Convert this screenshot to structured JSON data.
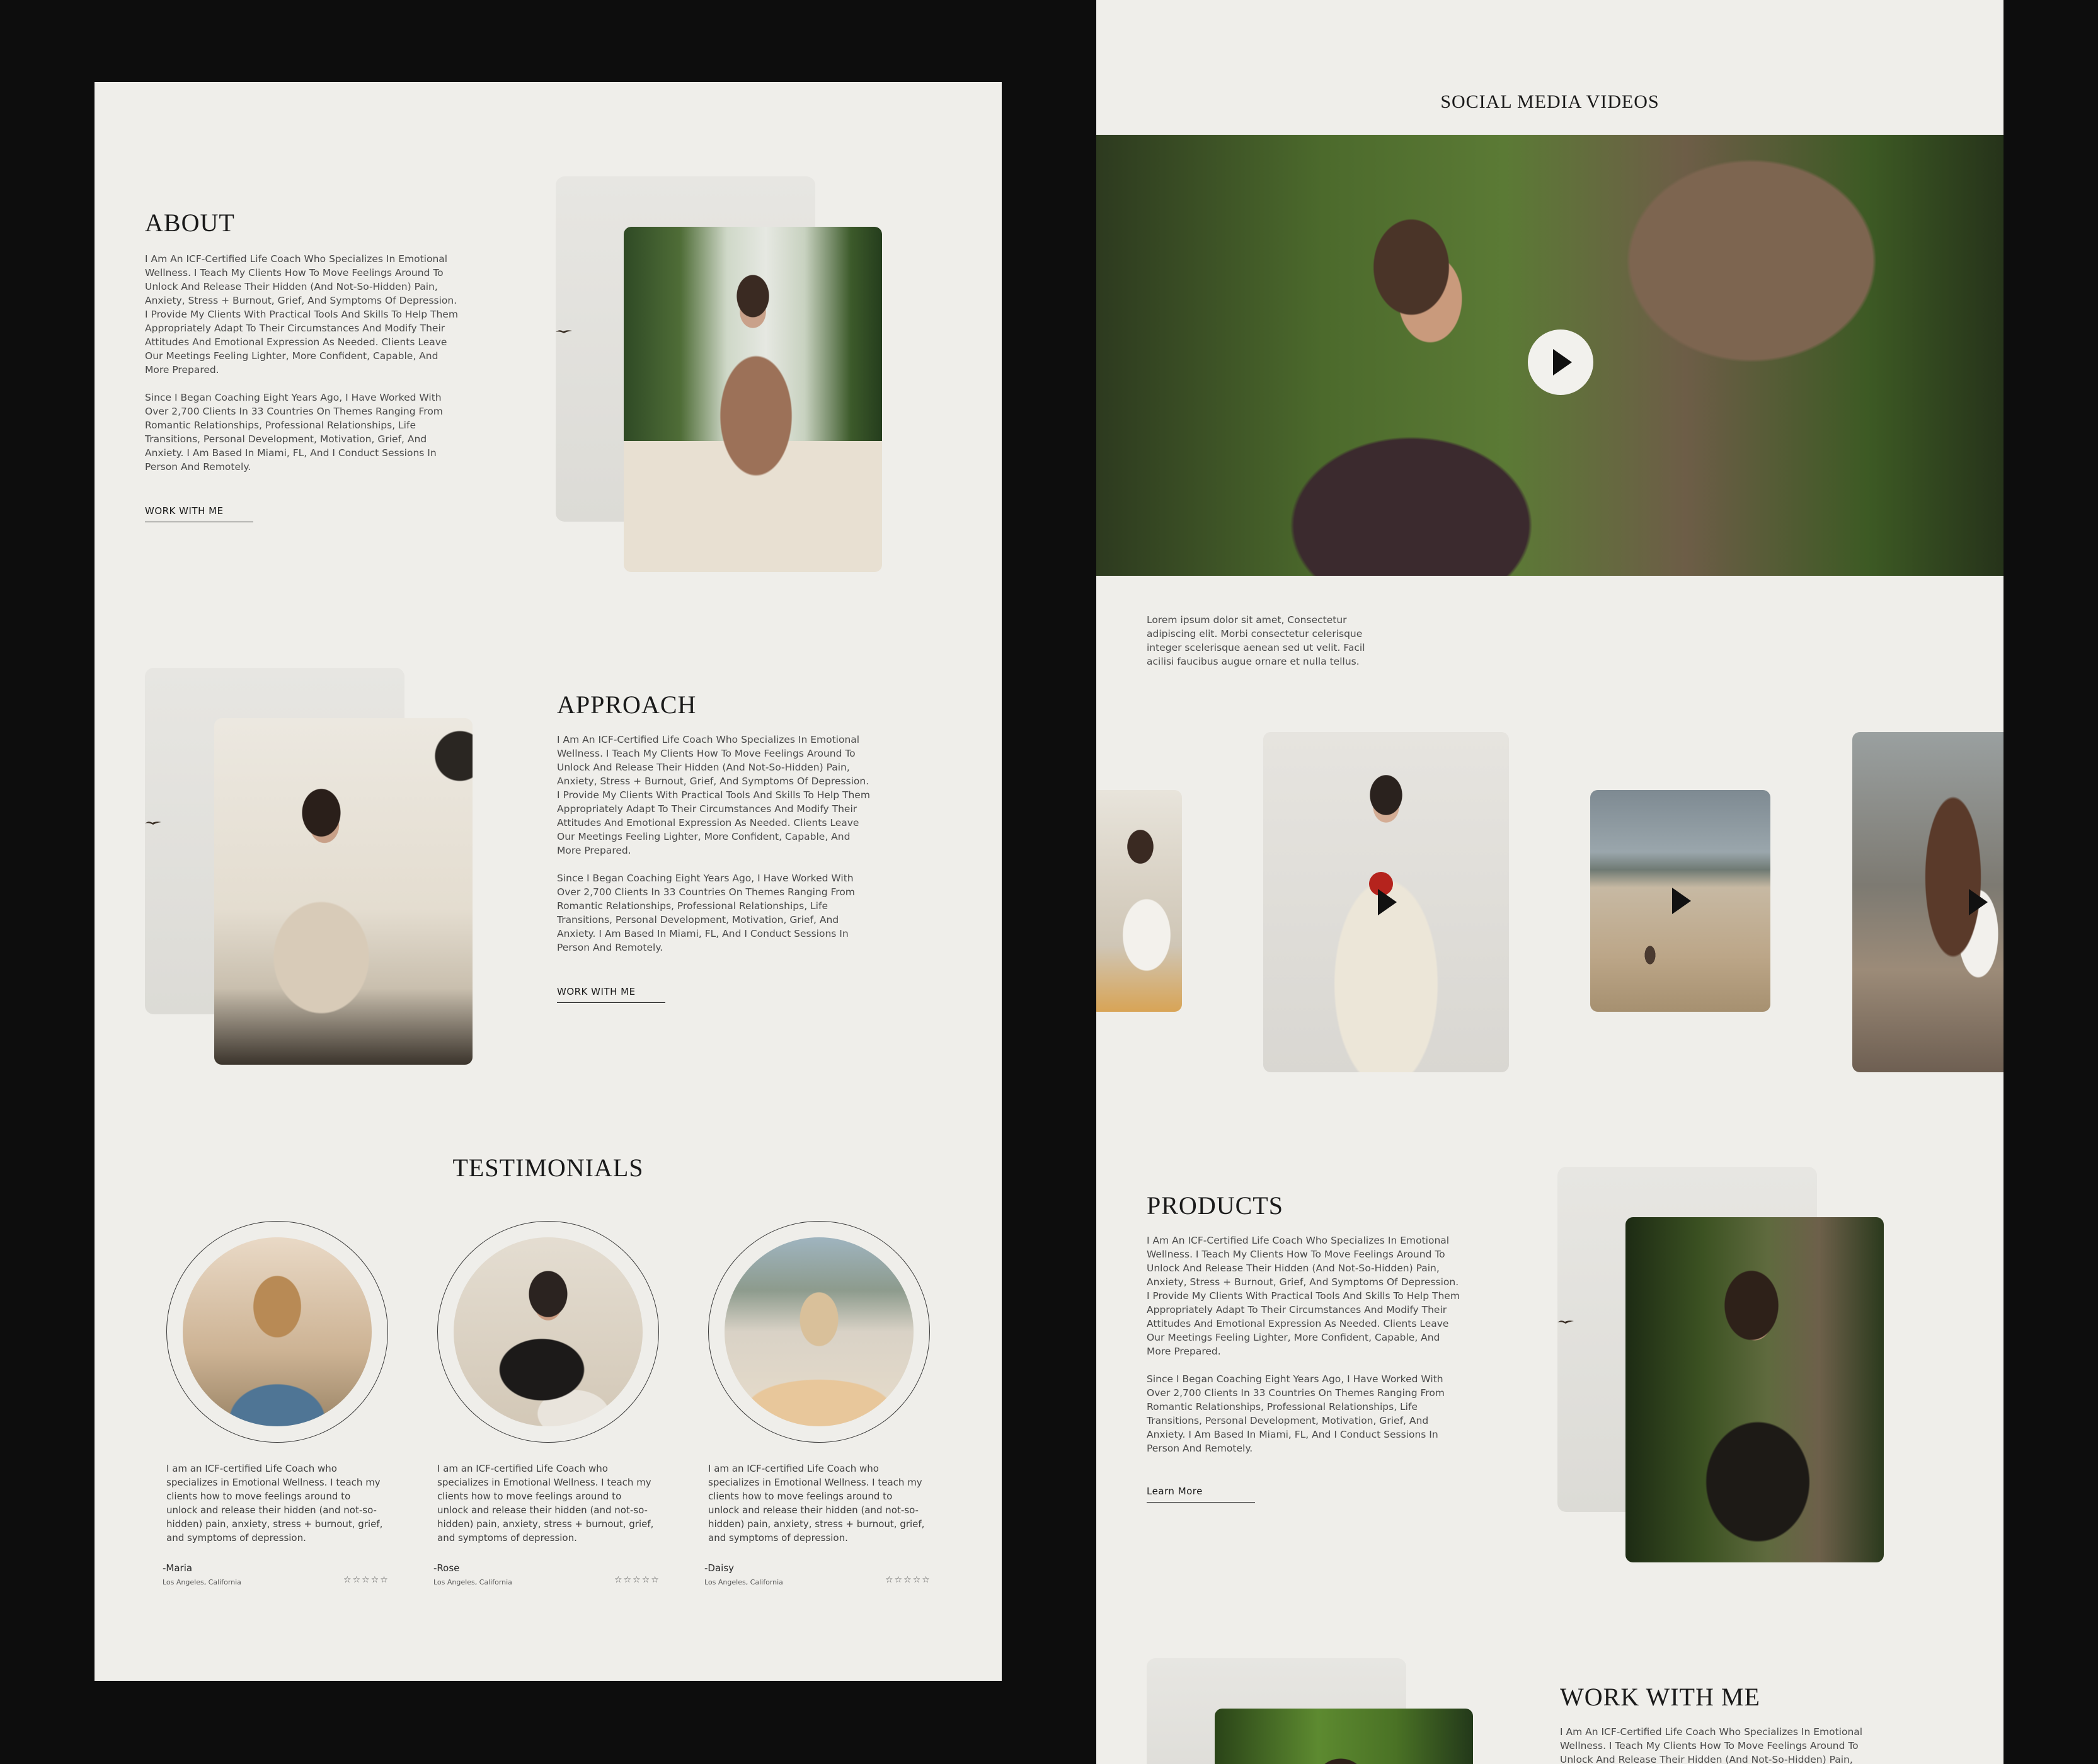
{
  "left_page": {
    "about": {
      "title": "ABOUT",
      "paragraph_1": "I Am An ICF-Certified Life Coach Who Specializes In Emotional Wellness. I Teach My Clients How To Move Feelings Around To Unlock And Release Their Hidden (And Not-So-Hidden) Pain, Anxiety, Stress + Burnout, Grief, And Symptoms Of Depression. I Provide My Clients With Practical Tools And Skills To Help Them Appropriately Adapt To Their Circumstances And Modify Their Attitudes And Emotional Expression As Needed. Clients Leave Our Meetings Feeling Lighter, More Confident, Capable, And More Prepared.",
      "paragraph_2": "Since I Began Coaching Eight Years Ago, I Have Worked With Over 2,700 Clients In 33 Countries On Themes Ranging From Romantic Relationships, Professional Relationships, Life Transitions, Personal Development, Motivation, Grief, And Anxiety. I Am Based In Miami, FL, And I Conduct Sessions In Person And Remotely.",
      "cta": "WORK WITH ME"
    },
    "approach": {
      "title": "APPROACH",
      "paragraph_1": "I Am An ICF-Certified Life Coach Who Specializes In Emotional Wellness. I Teach My Clients How To Move Feelings Around To Unlock And Release Their Hidden (And Not-So-Hidden) Pain, Anxiety, Stress + Burnout, Grief, And Symptoms Of Depression. I Provide My Clients With Practical Tools And Skills To Help Them Appropriately Adapt To Their Circumstances And Modify Their Attitudes And Emotional Expression As Needed. Clients Leave Our Meetings Feeling Lighter, More Confident, Capable, And More Prepared.",
      "paragraph_2": "Since I Began Coaching Eight Years Ago, I Have Worked With Over 2,700 Clients In 33 Countries On Themes Ranging From Romantic Relationships, Professional Relationships, Life Transitions, Personal Development, Motivation, Grief, And Anxiety. I Am Based In Miami, FL, And I Conduct Sessions In Person And Remotely.",
      "cta": "WORK WITH ME"
    },
    "testimonials": {
      "title": "TESTIMONIALS",
      "items": [
        {
          "text": "I am an ICF-certified Life Coach who specializes in Emotional Wellness. I teach my clients how to move feelings around to unlock and release their hidden (and not-so-hidden) pain, anxiety, stress + burnout, grief,  and symptoms of depression.",
          "name": "-Maria",
          "location": "Los Angeles, California",
          "stars": "☆☆☆☆☆"
        },
        {
          "text": "I am an ICF-certified Life Coach who specializes in Emotional Wellness. I teach my clients how to move feelings around to unlock and release their hidden (and not-so-hidden) pain, anxiety, stress + burnout, grief,  and symptoms of depression.",
          "name": "-Rose",
          "location": "Los Angeles, California",
          "stars": "☆☆☆☆☆"
        },
        {
          "text": "I am an ICF-certified Life Coach who specializes in Emotional Wellness. I teach my clients how to move feelings around to unlock and release their hidden (and not-so-hidden) pain, anxiety, stress + burnout, grief,  and symptoms of depression.",
          "name": "-Daisy",
          "location": "Los Angeles, California",
          "stars": "☆☆☆☆☆"
        }
      ]
    }
  },
  "right_page": {
    "social": {
      "title": "SOCIAL MEDIA VIDEOS",
      "description": "Lorem ipsum dolor sit amet, Consectetur  adipiscing elit. Morbi consectetur celerisque integer scelerisque aenean sed ut velit. Facil acilisi faucibus augue ornare et nulla tellus."
    },
    "products": {
      "title": "PRODUCTS",
      "paragraph_1": "I Am An ICF-Certified Life Coach Who Specializes In Emotional Wellness. I Teach My Clients How To Move Feelings Around To Unlock And Release Their Hidden (And Not-So-Hidden) Pain, Anxiety, Stress + Burnout, Grief, And Symptoms Of Depression. I Provide My Clients With Practical Tools And Skills To Help Them Appropriately Adapt To Their Circumstances And Modify Their Attitudes And Emotional Expression As Needed. Clients Leave Our Meetings Feeling Lighter, More Confident, Capable, And More Prepared.",
      "paragraph_2": "Since I Began Coaching Eight Years Ago, I Have Worked With Over 2,700 Clients In 33 Countries On Themes Ranging From Romantic Relationships, Professional Relationships, Life Transitions, Personal Development, Motivation, Grief, And Anxiety. I Am Based In Miami, FL, And I Conduct Sessions In Person And Remotely.",
      "cta": "Learn More"
    },
    "work_with_me": {
      "title": "WORK WITH ME",
      "paragraph_1": "I Am An ICF-Certified Life Coach Who Specializes In Emotional Wellness. I Teach My Clients How To Move Feelings Around To Unlock And Release Their Hidden (And Not-So-Hidden) Pain,"
    }
  },
  "colors": {
    "page_background": "#0d0d0d",
    "card_background": "#efeeea",
    "text": "#1a1a1a"
  },
  "icons": [
    "bird-icon",
    "play-icon"
  ]
}
